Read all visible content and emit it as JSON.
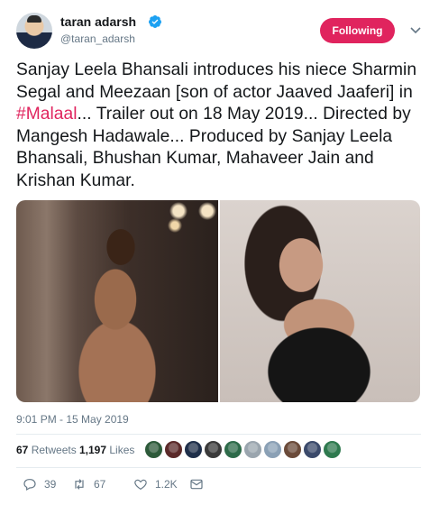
{
  "author": {
    "name": "taran adarsh",
    "handle": "@taran_adarsh",
    "verified": true,
    "avatar_icon": "avatar-photo"
  },
  "follow": {
    "label": "Following",
    "color": "#e0245e"
  },
  "tweet": {
    "text_before": "Sanjay Leela Bhansali introduces his niece Sharmin Segal and Meezaan [son of actor Jaaved Jaaferi] in ",
    "hashtag": "#Malaal",
    "text_after": "... Trailer out on 18 May 2019... Directed by Mangesh Hadawale... Produced by Sanjay Leela Bhansali, Bhushan Kumar, Mahaveer Jain and Krishan Kumar.",
    "hashtag_color": "#e0245e"
  },
  "media": {
    "photos": [
      "photo-left",
      "photo-right"
    ]
  },
  "timestamp": "9:01 PM - 15 May 2019",
  "stats": {
    "retweets_count": "67",
    "retweets_label": "Retweets",
    "likes_count": "1,197",
    "likes_label": "Likes"
  },
  "likers": {
    "colors": [
      "#2d5a3a",
      "#5b2a2a",
      "#1f2f4a",
      "#3a3a3a",
      "#2e6b4a",
      "#9aa5ae",
      "#8aa0b5",
      "#6b4b3a",
      "#3b4a6b",
      "#2f7a4f"
    ]
  },
  "actions": {
    "replies": "39",
    "retweets": "67",
    "likes": "1.2K",
    "icons": [
      "reply-icon",
      "retweet-icon",
      "like-icon",
      "direct-message-icon"
    ]
  }
}
